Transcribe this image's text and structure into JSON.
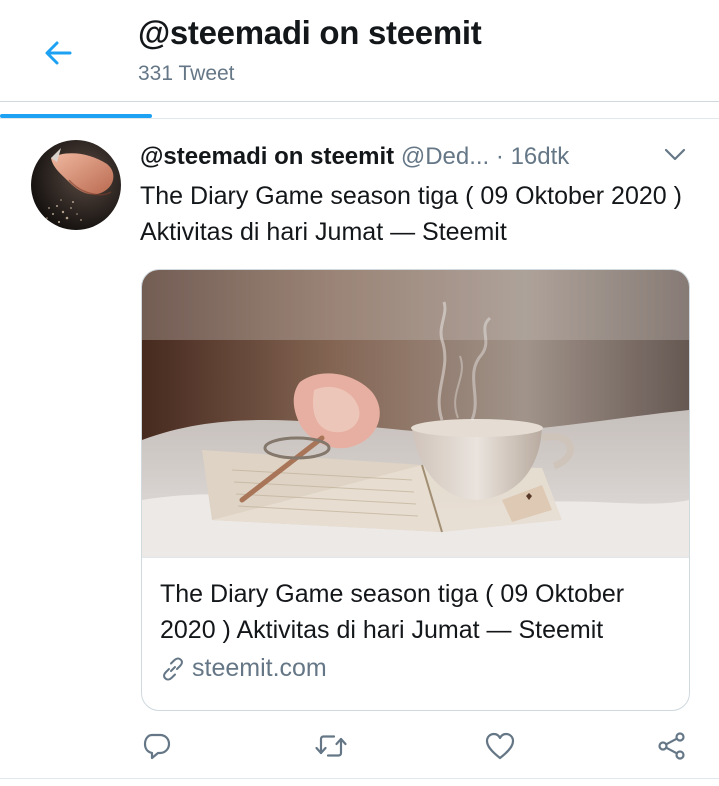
{
  "header": {
    "back_icon": "arrow-left-icon",
    "title": "@steemadi on steemit",
    "subtitle": "331 Tweet"
  },
  "tweet": {
    "avatar_icon": "hand-sand-photo",
    "author": "@steemadi on steemit",
    "handle": "@Ded...",
    "separator": "·",
    "time": "16dtk",
    "menu_icon": "chevron-down-icon",
    "text": "The Diary Game season tiga ( 09 Oktober 2020 ) Aktivitas di hari Jumat — Steemit",
    "card": {
      "image_icon": "tea-cup-book-photo",
      "title": "The Diary Game season tiga ( 09 Oktober 2020 ) Aktivitas di hari Jumat — Steemit",
      "link_icon": "link-icon",
      "domain": "steemit.com"
    },
    "actions": {
      "reply_icon": "reply-icon",
      "retweet_icon": "retweet-icon",
      "like_icon": "heart-icon",
      "share_icon": "share-icon"
    }
  },
  "colors": {
    "accent": "#1da1f2",
    "text_primary": "#14171a",
    "text_secondary": "#657786",
    "border": "#cfd9de"
  }
}
